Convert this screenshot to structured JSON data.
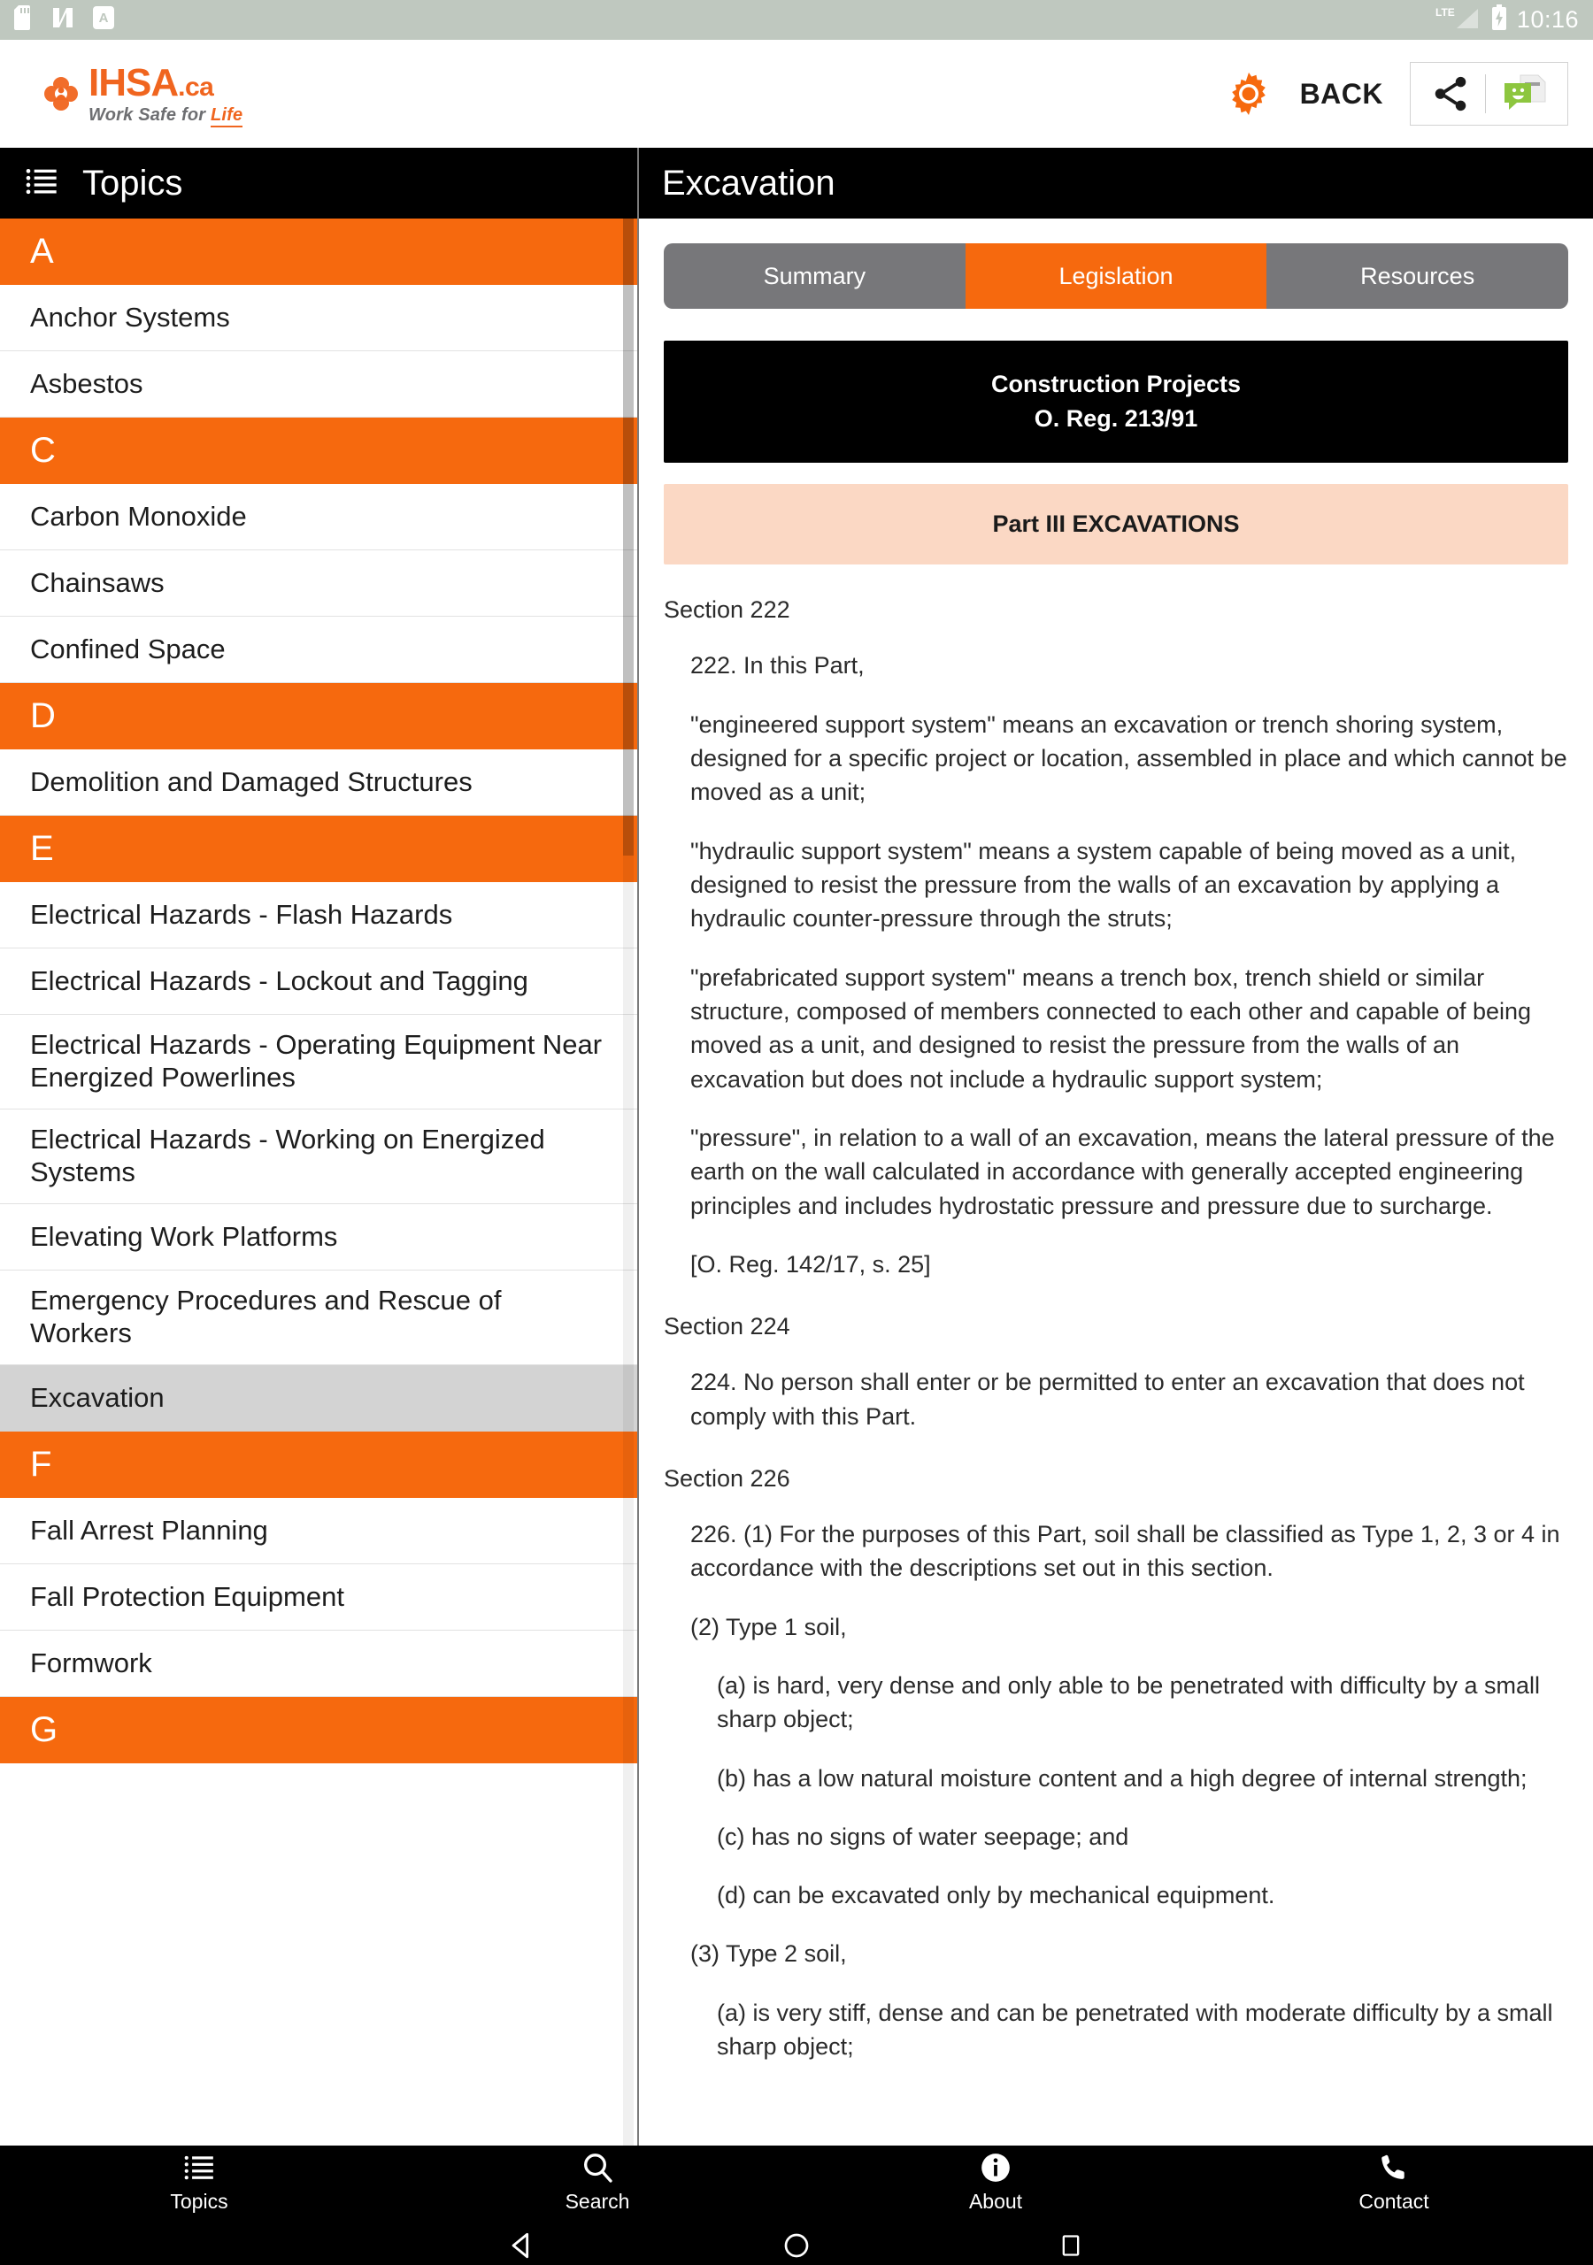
{
  "statusbar": {
    "icons": [
      "sd-card-icon",
      "nougat-icon",
      "a-badge-icon"
    ],
    "network": "LTE",
    "battery": "battery-charging-icon",
    "time": "10:16"
  },
  "header": {
    "logo_name": "IHSA",
    "logo_suffix": ".ca",
    "tagline_prefix": "Work Safe for ",
    "tagline_accent": "Life",
    "settings_icon": "gear-icon",
    "back_label": "BACK",
    "share_icon": "share-icon",
    "message_icon": "messaging-icon"
  },
  "sidebar": {
    "title": "Topics",
    "menu_icon": "list-icon",
    "selected": "Excavation",
    "groups": [
      {
        "letter": "A",
        "items": [
          "Anchor Systems",
          "Asbestos"
        ]
      },
      {
        "letter": "C",
        "items": [
          "Carbon Monoxide",
          "Chainsaws",
          "Confined Space"
        ]
      },
      {
        "letter": "D",
        "items": [
          "Demolition and Damaged Structures"
        ]
      },
      {
        "letter": "E",
        "items": [
          "Electrical Hazards - Flash Hazards",
          "Electrical Hazards - Lockout and Tagging",
          "Electrical Hazards - Operating Equipment Near Energized Powerlines",
          "Electrical Hazards - Working on Energized Systems",
          "Elevating Work Platforms",
          "Emergency Procedures and Rescue of Workers",
          "Excavation"
        ]
      },
      {
        "letter": "F",
        "items": [
          "Fall Arrest Planning",
          "Fall Protection Equipment",
          "Formwork"
        ]
      },
      {
        "letter": "G",
        "items": []
      }
    ]
  },
  "content": {
    "title": "Excavation",
    "tabs": [
      {
        "label": "Summary",
        "active": false
      },
      {
        "label": "Legislation",
        "active": true
      },
      {
        "label": "Resources",
        "active": false
      }
    ],
    "reg_title_line1": "Construction Projects",
    "reg_title_line2": "O. Reg. 213/91",
    "part_title": "Part III EXCAVATIONS",
    "blocks": [
      {
        "kind": "section",
        "text": "Section 222"
      },
      {
        "kind": "para",
        "indent": 1,
        "text": "222. In this Part,"
      },
      {
        "kind": "para",
        "indent": 1,
        "text": "\"engineered support system\" means an excavation or trench shoring system, designed for a specific project or location, assembled in place and which cannot be moved as a unit;"
      },
      {
        "kind": "para",
        "indent": 1,
        "text": "\"hydraulic support system\" means a system capable of being moved as a unit, designed to resist the pressure from the walls of an excavation by applying a hydraulic counter-pressure through the struts;"
      },
      {
        "kind": "para",
        "indent": 1,
        "text": "\"prefabricated support system\" means a trench box, trench shield or similar structure, composed of members connected to each other and capable of being moved as a unit, and designed to resist the pressure from the walls of an excavation but does not include a hydraulic support system;"
      },
      {
        "kind": "para",
        "indent": 1,
        "text": "\"pressure\", in relation to a wall of an excavation, means the lateral pressure of the earth on the wall calculated in accordance with generally accepted engineering principles and includes hydrostatic pressure and pressure due to surcharge."
      },
      {
        "kind": "para",
        "indent": 1,
        "text": "[O. Reg. 142/17, s. 25]"
      },
      {
        "kind": "section",
        "text": "Section 224"
      },
      {
        "kind": "para",
        "indent": 1,
        "text": "224. No person shall enter or be permitted to enter an excavation that does not comply with this Part."
      },
      {
        "kind": "section",
        "text": "Section 226"
      },
      {
        "kind": "para",
        "indent": 1,
        "text": "226. (1) For the purposes of this Part, soil shall be classified as Type 1, 2, 3 or 4 in accordance with the descriptions set out in this section."
      },
      {
        "kind": "para",
        "indent": 1,
        "text": "(2) Type 1 soil,"
      },
      {
        "kind": "para",
        "indent": 2,
        "text": "(a) is hard, very dense and only able to be penetrated with difficulty by a small sharp object;"
      },
      {
        "kind": "para",
        "indent": 2,
        "text": "(b) has a low natural moisture content and a high degree of internal strength;"
      },
      {
        "kind": "para",
        "indent": 2,
        "text": "(c) has no signs of water seepage; and"
      },
      {
        "kind": "para",
        "indent": 2,
        "text": "(d) can be excavated only by mechanical equipment."
      },
      {
        "kind": "para",
        "indent": 1,
        "text": "(3) Type 2 soil,"
      },
      {
        "kind": "para",
        "indent": 2,
        "text": "(a) is very stiff, dense and can be penetrated with moderate difficulty by a small sharp object;"
      }
    ]
  },
  "bottomnav": {
    "items": [
      {
        "label": "Topics",
        "icon": "list-icon"
      },
      {
        "label": "Search",
        "icon": "search-icon"
      },
      {
        "label": "About",
        "icon": "info-icon"
      },
      {
        "label": "Contact",
        "icon": "phone-icon"
      }
    ]
  },
  "systemnav": {
    "back": "back-triangle-icon",
    "home": "home-circle-icon",
    "recents": "recents-square-icon"
  },
  "colors": {
    "accent_orange": "#f6690e",
    "status_bar": "#bfc8bf",
    "peach": "#fbd8c4",
    "tab_inactive": "#77777a",
    "selected_row": "#d3d3d3"
  }
}
